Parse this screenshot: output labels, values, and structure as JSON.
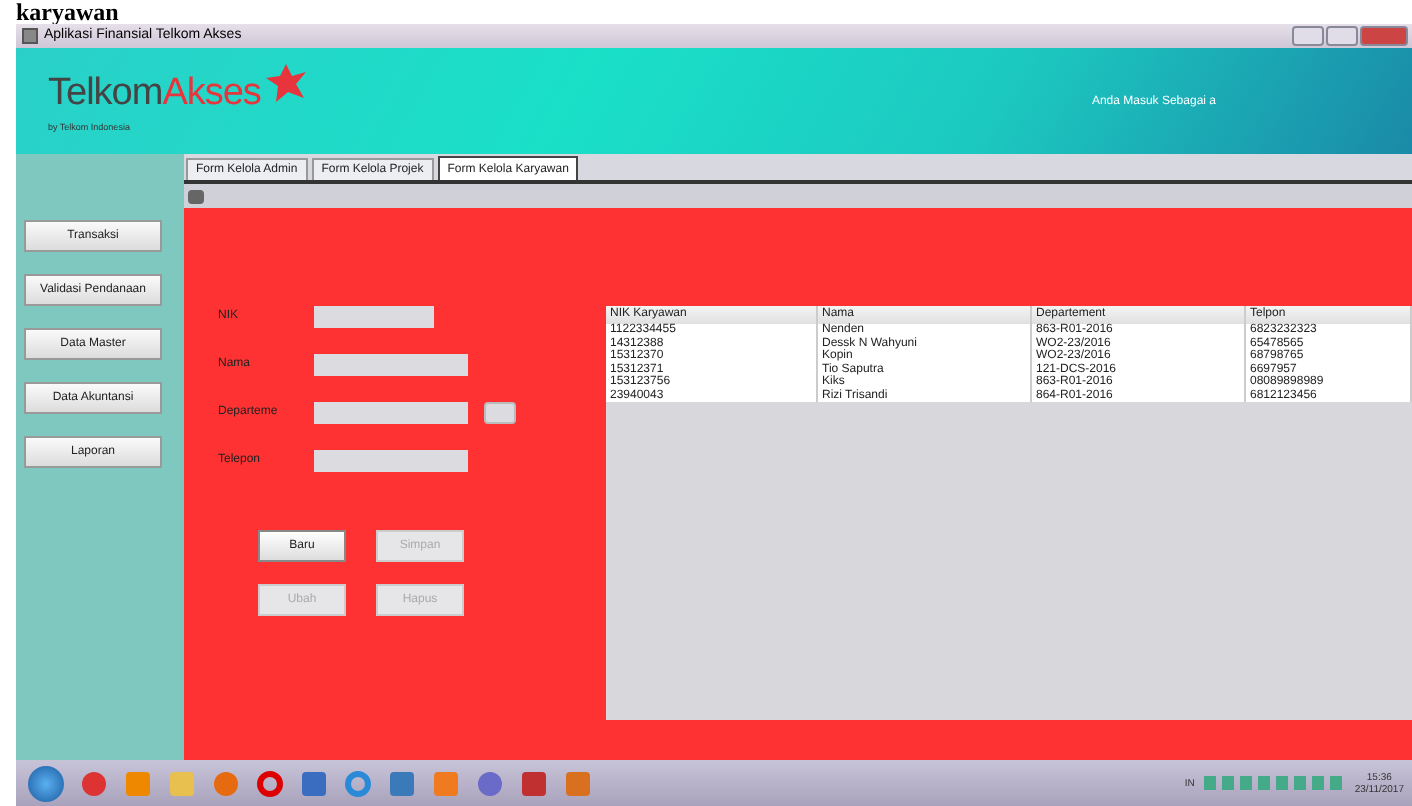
{
  "doc_heading": "karyawan",
  "window": {
    "title": "Aplikasi Finansial Telkom Akses"
  },
  "header": {
    "logo_part1": "Telkom",
    "logo_part2": "Akses",
    "tagline": "by Telkom Indonesia",
    "user_label": "Anda Masuk Sebagai a"
  },
  "tabs": [
    {
      "label": "Form Kelola Admin",
      "selected": false
    },
    {
      "label": "Form Kelola Projek",
      "selected": false
    },
    {
      "label": "Form Kelola Karyawan",
      "selected": true
    }
  ],
  "sidebar": {
    "items": [
      "Transaksi",
      "Validasi Pendanaan",
      "Data Master",
      "Data Akuntansi",
      "Laporan"
    ]
  },
  "form": {
    "fields": [
      {
        "label": "NIK",
        "kind": "short"
      },
      {
        "label": "Nama",
        "kind": "long"
      },
      {
        "label": "Departeme",
        "kind": "browse"
      },
      {
        "label": "Telepon",
        "kind": "long"
      }
    ],
    "buttons": [
      {
        "label": "Baru",
        "disabled": false
      },
      {
        "label": "Simpan",
        "disabled": true
      },
      {
        "label": "Ubah",
        "disabled": true
      },
      {
        "label": "Hapus",
        "disabled": true
      }
    ]
  },
  "table": {
    "columns": [
      "NIK Karyawan",
      "Nama",
      "Departement",
      "Telpon"
    ],
    "rows": [
      [
        "1122334455",
        "Nenden",
        "863-R01-2016",
        "6823232323"
      ],
      [
        "14312388",
        "Dessk N Wahyuni",
        "WO2-23/2016",
        "65478565"
      ],
      [
        "15312370",
        "Kopin",
        "WO2-23/2016",
        "68798765"
      ],
      [
        "15312371",
        "Tio Saputra",
        "121-DCS-2016",
        "6697957"
      ],
      [
        "153123756",
        "Kiks",
        "863-R01-2016",
        "08089898989"
      ],
      [
        "23940043",
        "Rizi Trisandi",
        "864-R01-2016",
        "6812123456"
      ]
    ]
  },
  "taskbar": {
    "language": "IN",
    "time": "15:36",
    "date": "23/11/2017"
  }
}
